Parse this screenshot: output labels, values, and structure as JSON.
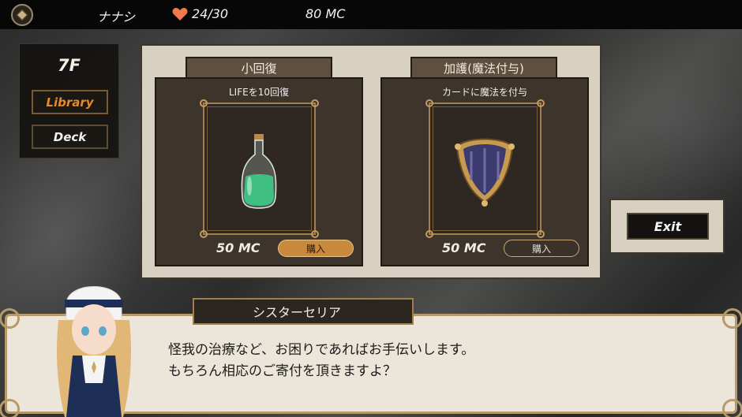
{
  "topbar": {
    "player_name": "ナナシ",
    "hp": "24/30",
    "money": "80 MC",
    "menu_icon": "menu-gem-icon",
    "heart_icon": "heart-icon",
    "heart_color": "#f07a4a"
  },
  "side": {
    "floor": "7F",
    "library_label": "Library",
    "deck_label": "Deck",
    "accent_color": "#e58a2a"
  },
  "shop": {
    "items": [
      {
        "title": "小回復",
        "description": "LIFEを10回復",
        "icon": "green-potion-bottle-icon",
        "price": "50 MC",
        "buy_label": "購入",
        "buy_state": "active"
      },
      {
        "title": "加護(魔法付与)",
        "description": "カードに魔法を付与",
        "icon": "shield-crest-icon",
        "price": "50 MC",
        "buy_label": "購入",
        "buy_state": "inactive"
      }
    ]
  },
  "exit_label": "Exit",
  "dialog": {
    "speaker": "シスターセリア",
    "lines": [
      "怪我の治療など、お困りであればお手伝いします。",
      "もちろん相応のご寄付を頂きますよ？"
    ],
    "portrait": "nun-character-portrait"
  }
}
